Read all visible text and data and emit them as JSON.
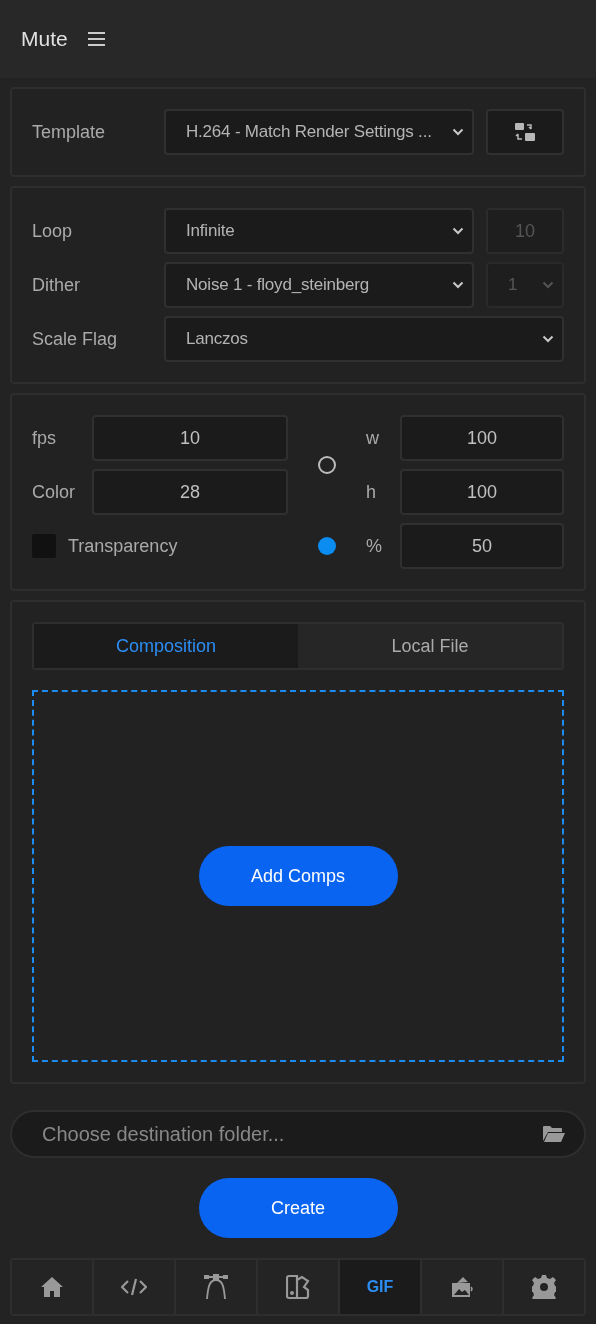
{
  "header": {
    "title": "Mute"
  },
  "template": {
    "label": "Template",
    "value": "H.264 - Match Render Settings ..."
  },
  "options": [
    {
      "label": "Loop",
      "value": "Infinite",
      "side": {
        "kind": "number",
        "value": "10",
        "disabled": true
      }
    },
    {
      "label": "Dither",
      "value": "Noise 1 - floyd_steinberg",
      "side": {
        "kind": "select",
        "value": "1",
        "disabled": true
      }
    },
    {
      "label": "Scale Flag",
      "value": "Lanczos"
    }
  ],
  "size": {
    "fields": [
      {
        "label": "fps",
        "value": "10"
      },
      {
        "label": "Color",
        "value": "28"
      }
    ],
    "transparency": {
      "label": "Transparency",
      "checked": false
    },
    "modes": [
      {
        "selected": false,
        "fields": [
          {
            "label": "w",
            "value": "100"
          },
          {
            "label": "h",
            "value": "100"
          }
        ]
      },
      {
        "selected": true,
        "fields": [
          {
            "label": "%",
            "value": "50"
          }
        ]
      }
    ]
  },
  "tabs": [
    {
      "label": "Composition",
      "selected": true
    },
    {
      "label": "Local File",
      "selected": false
    }
  ],
  "add_button": "Add Comps",
  "destination": {
    "placeholder": "Choose destination folder..."
  },
  "create_button": "Create",
  "nav": [
    {
      "kind": "home",
      "selected": false
    },
    {
      "kind": "code",
      "selected": false
    },
    {
      "kind": "bezier",
      "selected": false
    },
    {
      "kind": "swatch",
      "selected": false
    },
    {
      "kind": "text",
      "label": "GIF",
      "selected": true
    },
    {
      "kind": "image",
      "selected": false
    },
    {
      "kind": "settings",
      "selected": false
    }
  ]
}
